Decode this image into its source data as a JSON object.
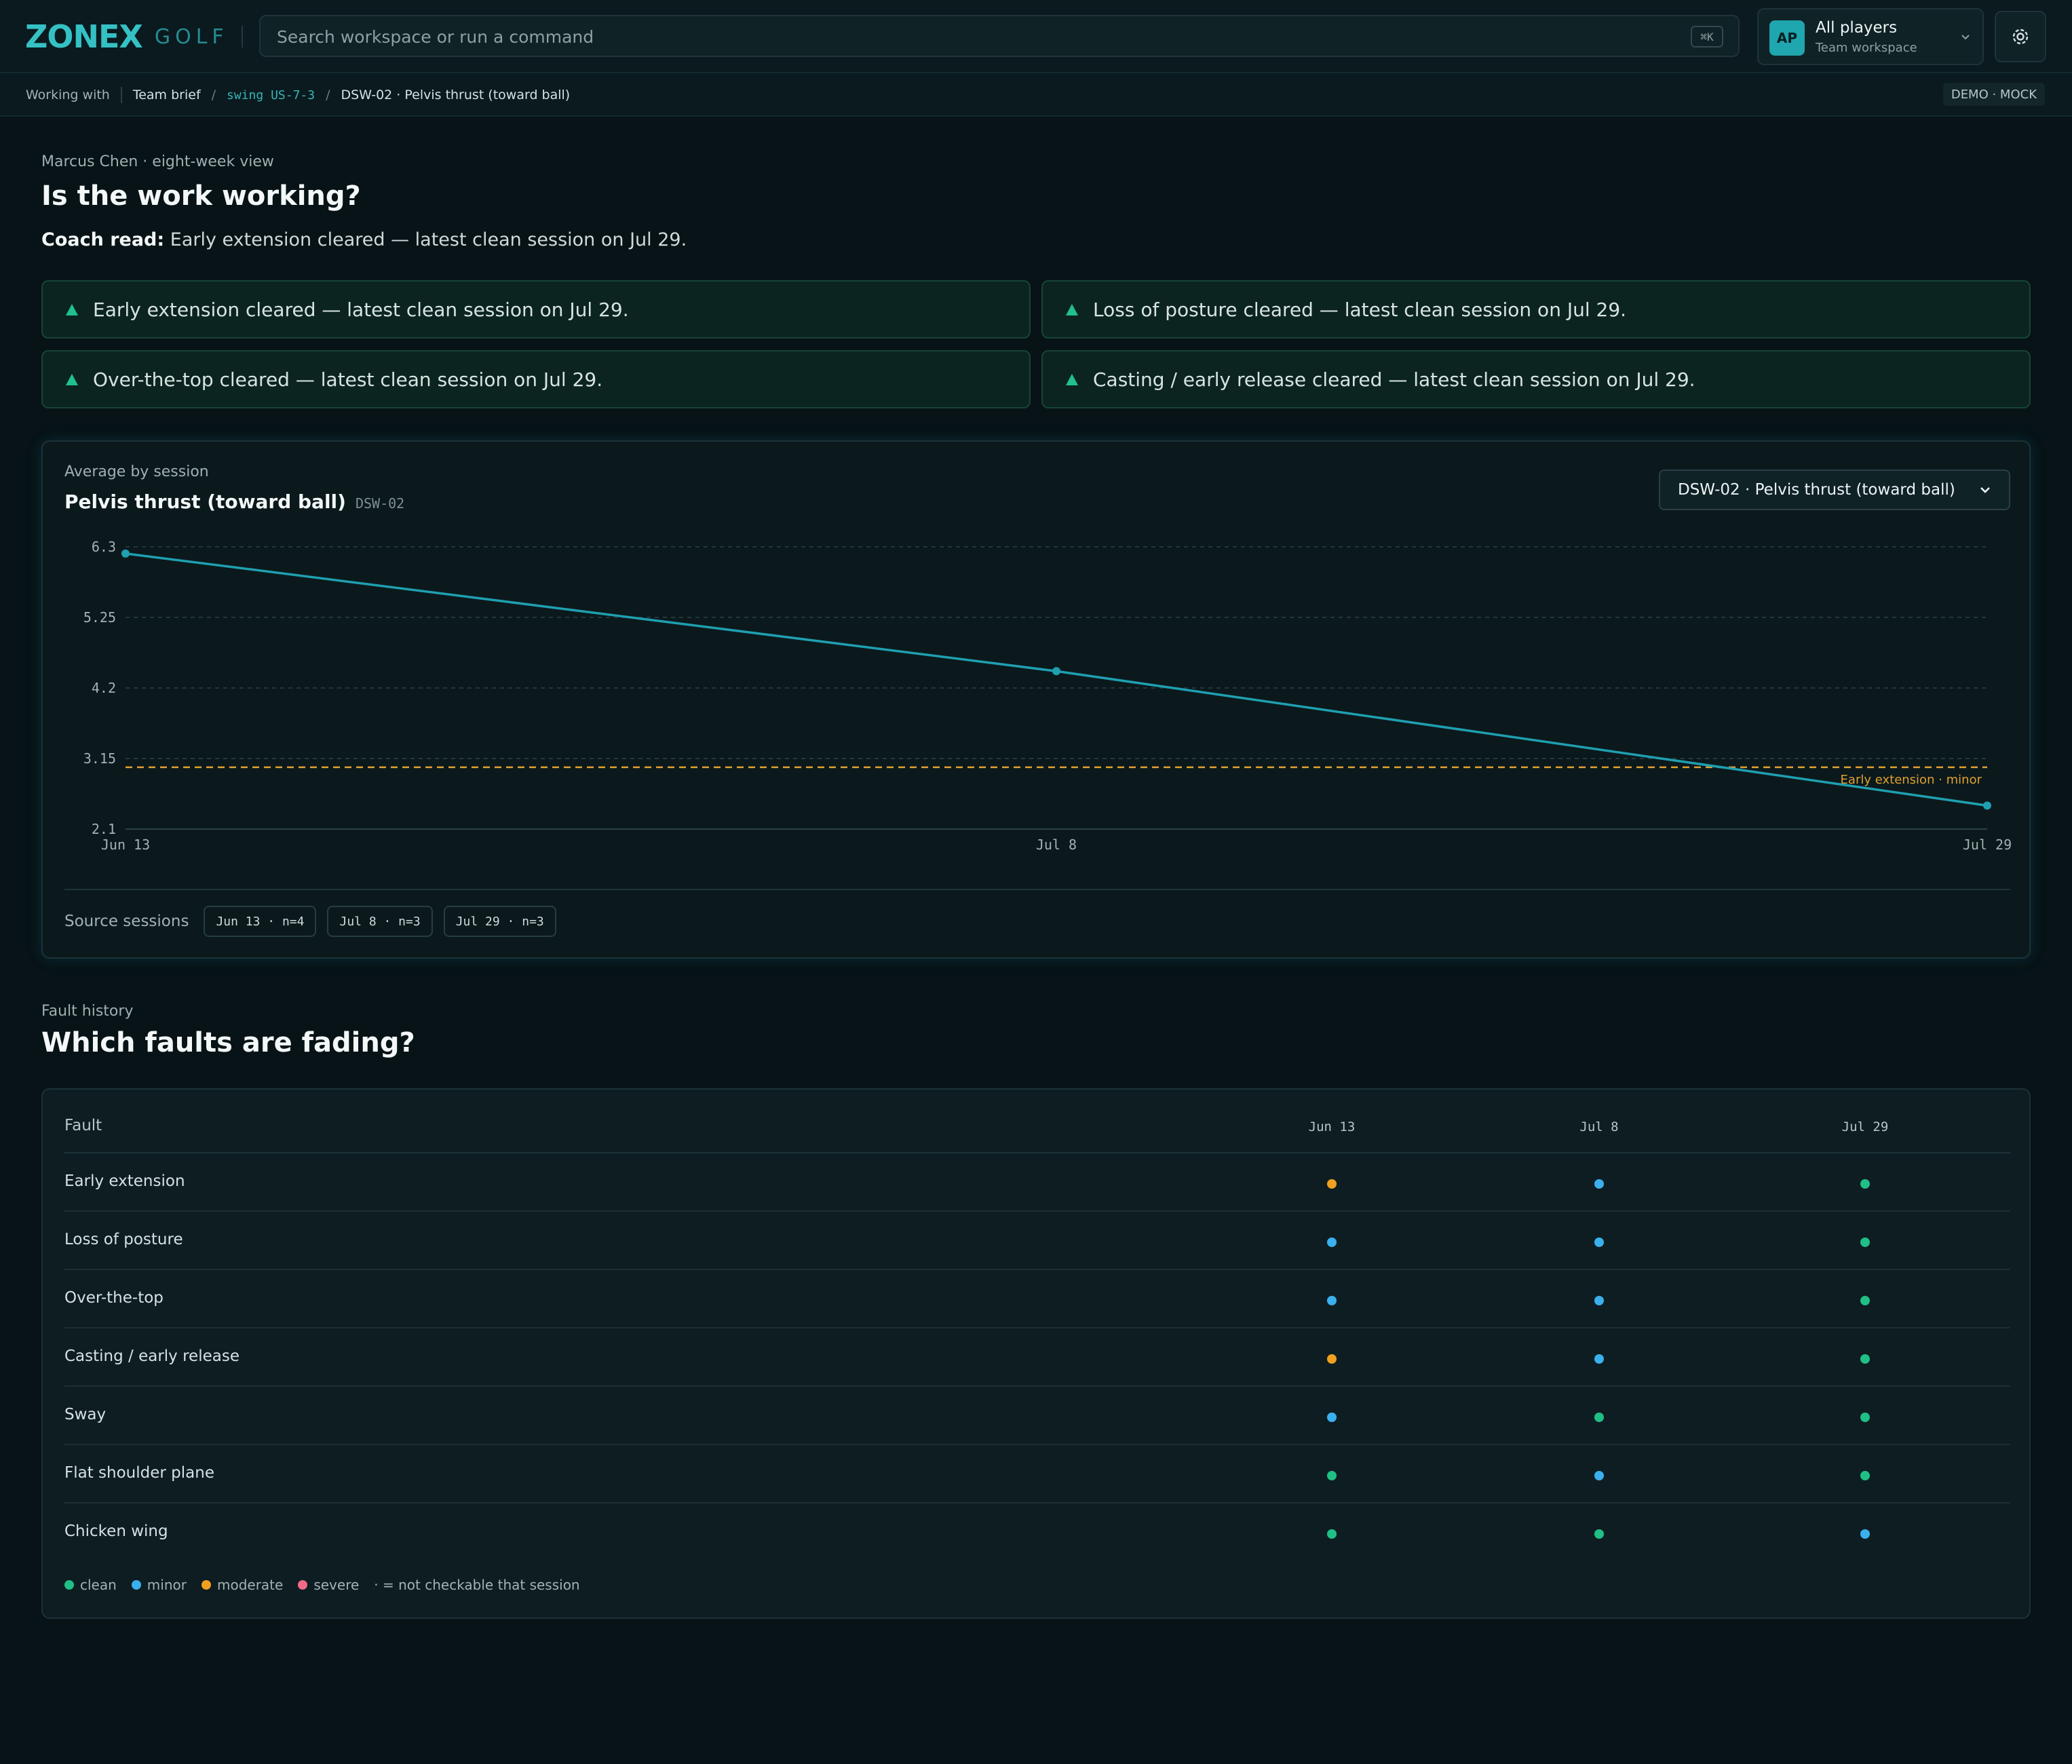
{
  "app": {
    "logo_main": "ZONEX",
    "logo_sub": "GOLF"
  },
  "search": {
    "placeholder": "Search workspace or run a command",
    "shortcut": "⌘K"
  },
  "workspace": {
    "initials": "AP",
    "title": "All players",
    "subtitle": "Team workspace"
  },
  "icons": {
    "settings": "gear-icon",
    "workspace_toggle": "chevron-down-icon",
    "insight": "triangle-up-icon",
    "select": "chevron-down-icon"
  },
  "breadcrumb": {
    "label": "Working with",
    "items": [
      "Team brief",
      "swing US-7-3",
      "DSW-02 · Pelvis thrust (toward ball)"
    ],
    "badge": "DEMO · MOCK"
  },
  "header": {
    "eyebrow": "Marcus Chen · eight-week view",
    "title": "Is the work working?",
    "coach_label": "Coach read:",
    "coach_text": " Early extension cleared — latest clean session on Jul 29."
  },
  "insights": [
    "Early extension cleared — latest clean session on Jul 29.",
    "Loss of posture cleared — latest clean session on Jul 29.",
    "Over-the-top cleared — latest clean session on Jul 29.",
    "Casting / early release cleared — latest clean session on Jul 29."
  ],
  "chart_card": {
    "eyebrow": "Average by session",
    "title": "Pelvis thrust (toward ball)",
    "code": "DSW-02",
    "select_value": "DSW-02 · Pelvis thrust (toward ball)",
    "source_label": "Source sessions",
    "sources": [
      "Jun 13 · n=4",
      "Jul 8 · n=3",
      "Jul 29 · n=3"
    ]
  },
  "chart_data": {
    "type": "line",
    "x": [
      "Jun 13",
      "Jul 8",
      "Jul 29"
    ],
    "series": [
      {
        "values": [
          6.2,
          4.45,
          2.45
        ]
      }
    ],
    "y_ticks": [
      "6.3",
      "5.25",
      "4.2",
      "3.15",
      "2.1"
    ],
    "ylim": [
      2.1,
      6.3
    ],
    "threshold": {
      "value": 3.02,
      "label": "Early extension · minor",
      "color": "#e0a030"
    },
    "line_color": "#1f9fb0",
    "grid": true
  },
  "faults_section": {
    "eyebrow": "Fault history",
    "title": "Which faults are fading?",
    "fault_header": "Fault",
    "dates": [
      "Jun 13",
      "Jul 8",
      "Jul 29"
    ],
    "rows": [
      {
        "name": "Early extension",
        "status": [
          "moderate",
          "minor",
          "clean"
        ]
      },
      {
        "name": "Loss of posture",
        "status": [
          "minor",
          "minor",
          "clean"
        ]
      },
      {
        "name": "Over-the-top",
        "status": [
          "minor",
          "minor",
          "clean"
        ]
      },
      {
        "name": "Casting / early release",
        "status": [
          "moderate",
          "minor",
          "clean"
        ]
      },
      {
        "name": "Sway",
        "status": [
          "minor",
          "clean",
          "clean"
        ]
      },
      {
        "name": "Flat shoulder plane",
        "status": [
          "clean",
          "minor",
          "clean"
        ]
      },
      {
        "name": "Chicken wing",
        "status": [
          "clean",
          "clean",
          "minor"
        ]
      }
    ],
    "legend": [
      {
        "key": "clean",
        "label": "clean"
      },
      {
        "key": "minor",
        "label": "minor"
      },
      {
        "key": "moderate",
        "label": "moderate"
      },
      {
        "key": "severe",
        "label": "severe"
      }
    ],
    "legend_note": "· = not checkable that session"
  },
  "colors": {
    "clean": "#1fbf86",
    "minor": "#3ab0ee",
    "moderate": "#f0a020",
    "severe": "#f06a86",
    "accent": "#35c1c4"
  }
}
